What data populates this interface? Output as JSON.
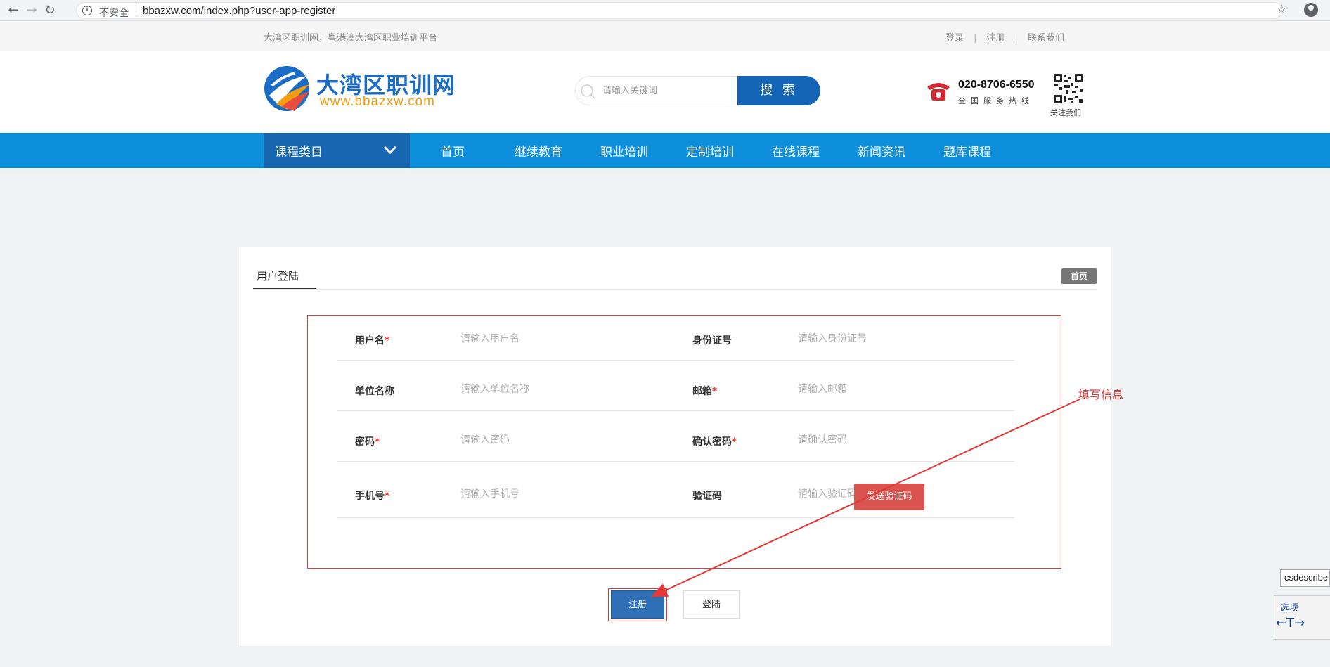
{
  "browser": {
    "security_label": "不安全",
    "url": "bbazxw.com/index.php?user-app-register"
  },
  "topbar": {
    "slogan": "大湾区职训网，粤港澳大湾区职业培训平台",
    "links": [
      "登录",
      "注册",
      "联系我们"
    ],
    "separator": "|"
  },
  "header": {
    "logo_cn": "大湾区职训网",
    "logo_en": "www.bbazxw.com",
    "search_placeholder": "请输入关键词",
    "search_button": "搜 索",
    "hotline_number": "020-8706-6550",
    "hotline_label": "全国服务热线",
    "qr_label": "关注我们"
  },
  "nav": {
    "category_label": "课程类目",
    "items": [
      "首页",
      "继续教育",
      "职业培训",
      "定制培训",
      "在线课程",
      "新闻资讯",
      "题库课程"
    ]
  },
  "card": {
    "tab": "用户登陆",
    "home_badge": "首页"
  },
  "form": {
    "required_mark": "*",
    "rows": [
      {
        "left": {
          "label": "用户名",
          "required": true,
          "placeholder": "请输入用户名"
        },
        "right": {
          "label": "身份证号",
          "required": false,
          "placeholder": "请输入身份证号"
        }
      },
      {
        "left": {
          "label": "单位名称",
          "required": false,
          "placeholder": "请输入单位名称"
        },
        "right": {
          "label": "邮箱",
          "required": true,
          "placeholder": "请输入邮箱"
        }
      },
      {
        "left": {
          "label": "密码",
          "required": true,
          "placeholder": "请输入密码"
        },
        "right": {
          "label": "确认密码",
          "required": true,
          "placeholder": "请确认密码"
        }
      },
      {
        "left": {
          "label": "手机号",
          "required": true,
          "placeholder": "请输入手机号"
        },
        "right": {
          "label": "验证码",
          "required": false,
          "placeholder": "请输入验证码"
        }
      }
    ],
    "send_code_button": "发送验证码",
    "register_button": "注册",
    "login_button": "登陆"
  },
  "annotation": {
    "text": "填写信息",
    "color": "#e53935"
  },
  "widget": {
    "input_value": "csdescribe",
    "option_label": "选项",
    "icon_text": "←T→"
  },
  "colors": {
    "nav_bg": "#0d8fdc",
    "category_bg": "#1766b0",
    "search_button": "#1565b7",
    "send_code": "#d9534f",
    "register": "#2f6fb5"
  }
}
